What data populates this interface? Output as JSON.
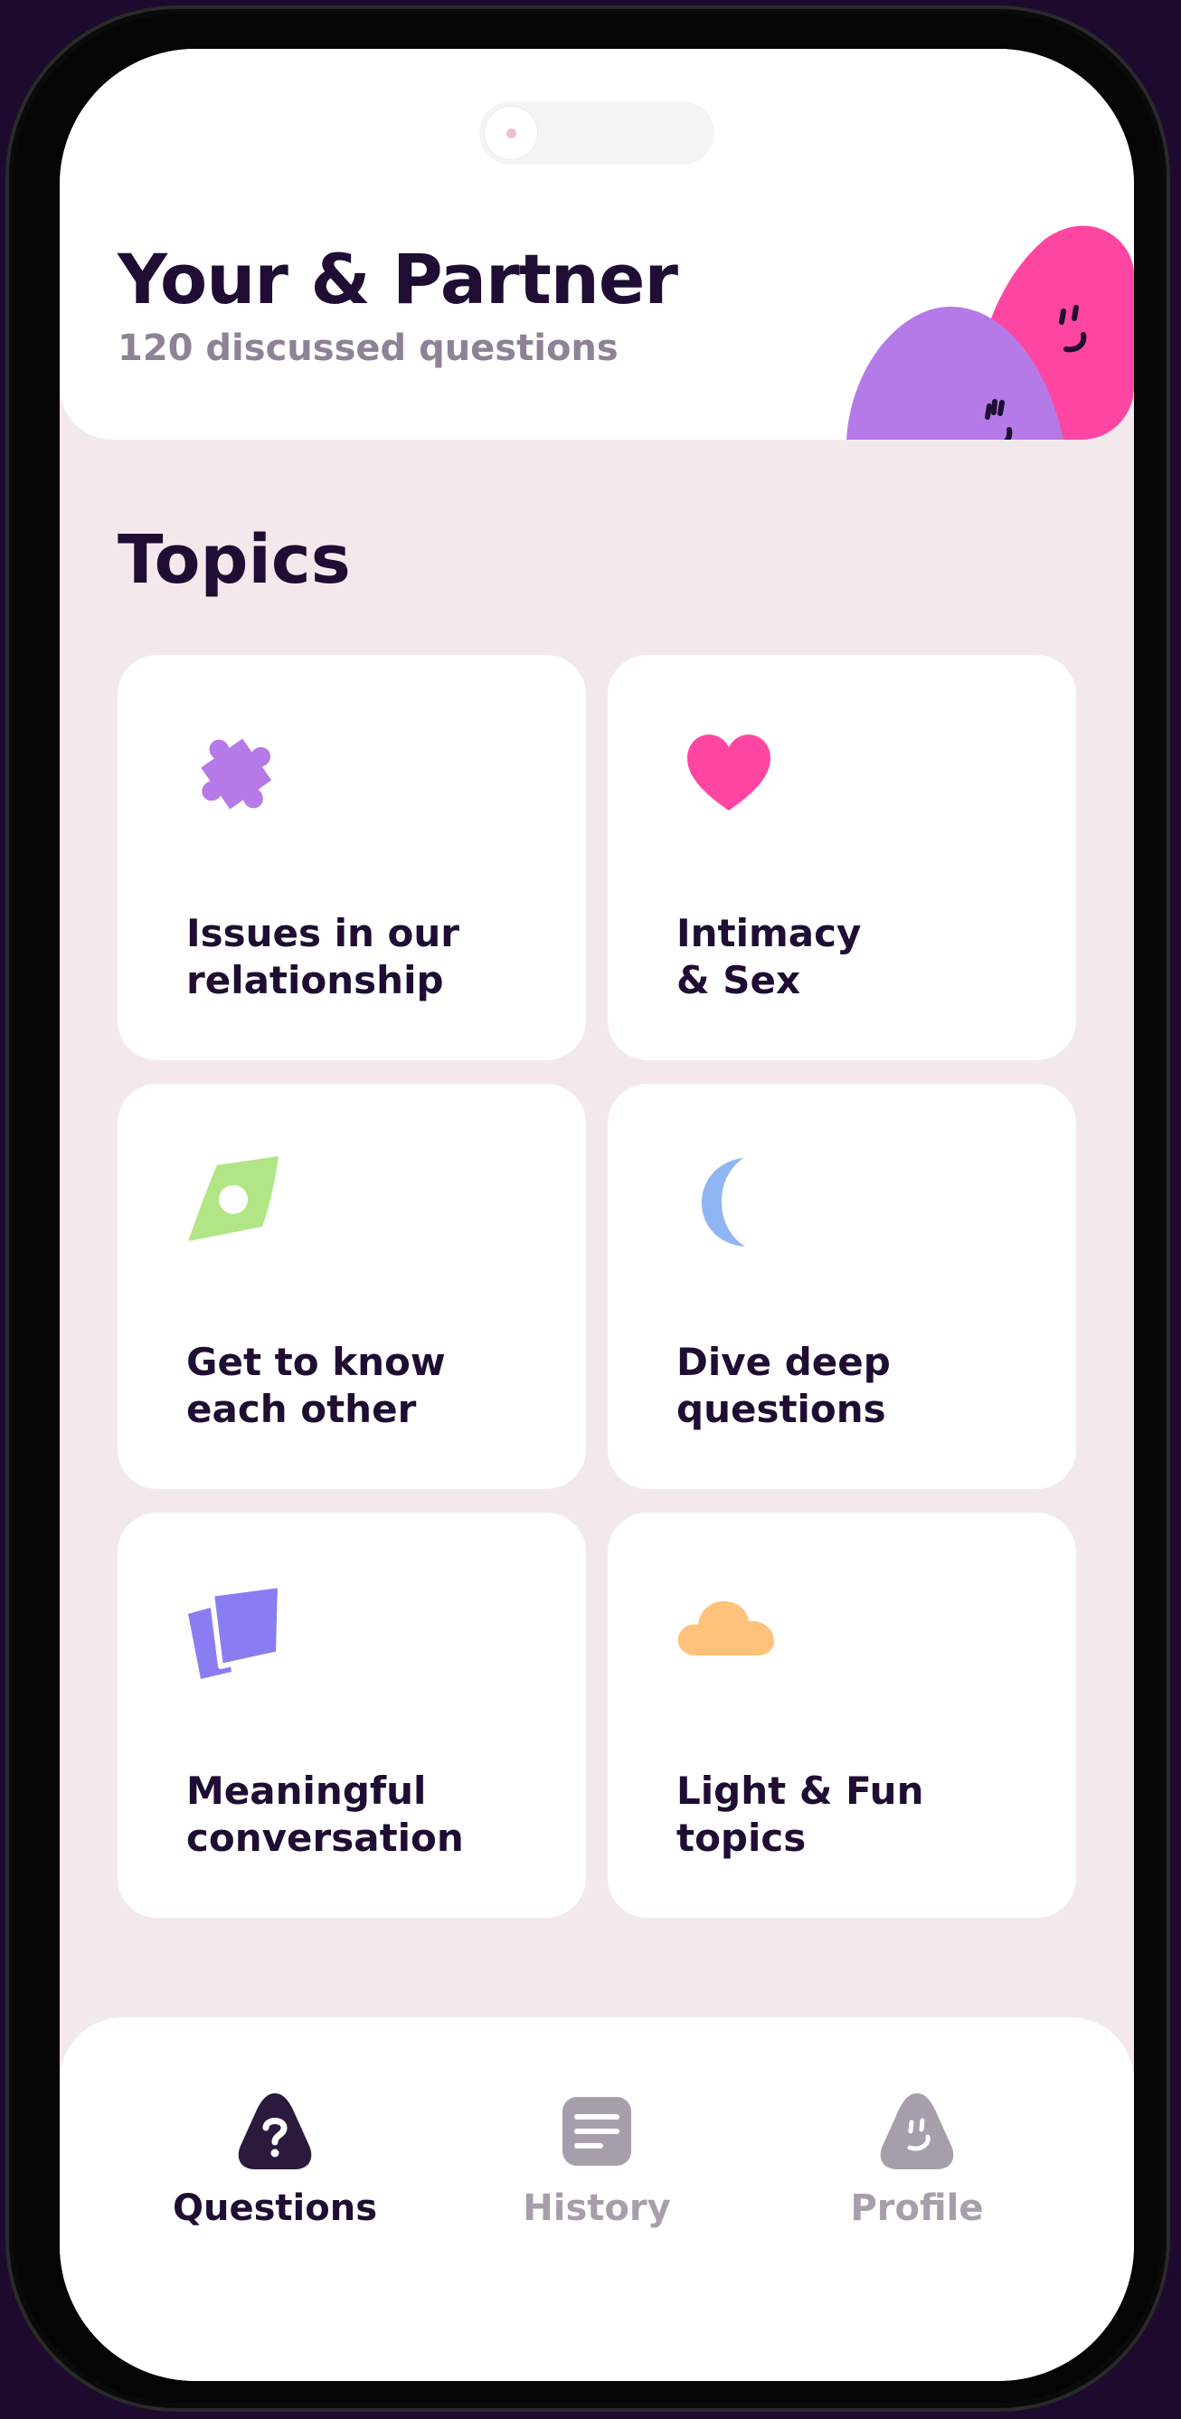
{
  "header": {
    "title": "Your & Partner",
    "subtitle": "120 discussed questions"
  },
  "topics": {
    "title": "Topics",
    "items": [
      {
        "line1": "Issues in our",
        "line2": "relationship",
        "icon": "puzzle-icon",
        "color": "#b57ae8"
      },
      {
        "line1": "Intimacy",
        "line2": "& Sex",
        "icon": "heart-icon",
        "color": "#ff45a2"
      },
      {
        "line1": "Get to know",
        "line2": "each other",
        "icon": "diamond-icon",
        "color": "#b2e585"
      },
      {
        "line1": "Dive deep",
        "line2": "questions",
        "icon": "moon-icon",
        "color": "#8fb5f2"
      },
      {
        "line1": "Meaningful",
        "line2": "conversation",
        "icon": "cards-icon",
        "color": "#8a7df2"
      },
      {
        "line1": "Light & Fun",
        "line2": "topics",
        "icon": "cloud-icon",
        "color": "#ffc27a"
      }
    ]
  },
  "tabs": [
    {
      "label": "Questions",
      "icon": "question-icon",
      "active": true
    },
    {
      "label": "History",
      "icon": "history-icon",
      "active": false
    },
    {
      "label": "Profile",
      "icon": "profile-icon",
      "active": false
    }
  ],
  "colors": {
    "background": "#f3e9ec",
    "text": "#1f0d33",
    "muted": "#8e8296",
    "blob_purple": "#b57ae8",
    "blob_pink": "#ff45a2"
  }
}
